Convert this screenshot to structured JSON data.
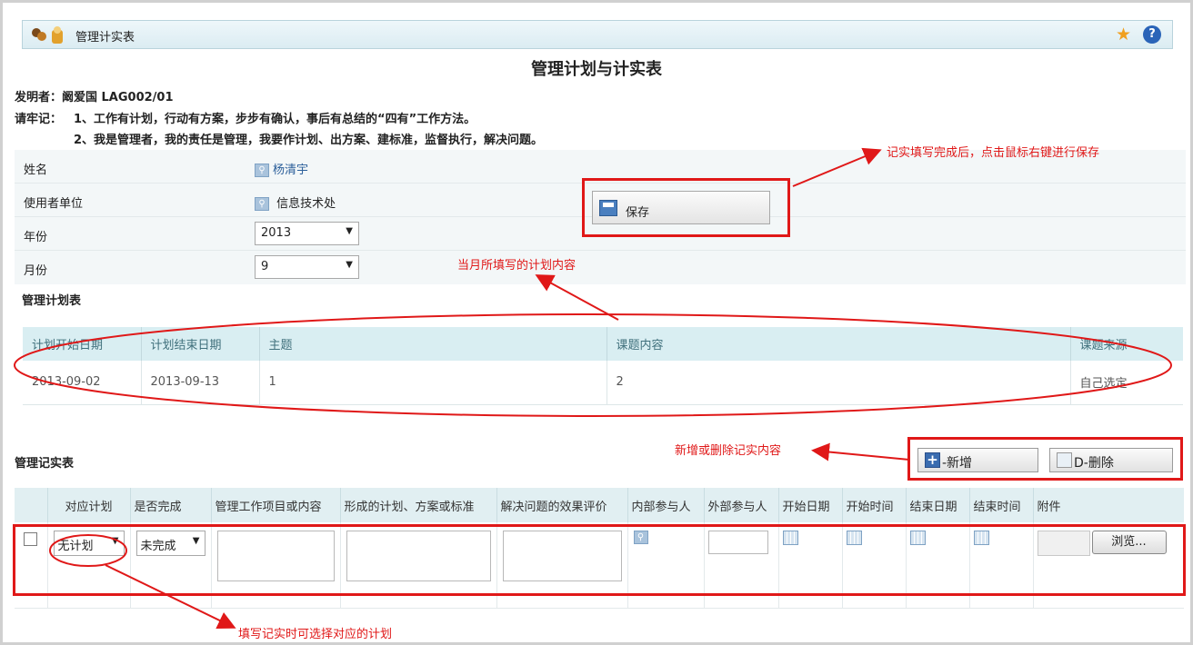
{
  "window": {
    "title": "管理计实表",
    "icons": [
      "users-icon",
      "star-icon",
      "help-icon"
    ]
  },
  "page_title": "管理计划与计实表",
  "inventor_line": "发明者：阚爱国 LAG002/01",
  "reminder_label": "请牢记：",
  "reminder_1": "1、工作有计划，行动有方案，步步有确认，事后有总结的“四有”工作方法。",
  "reminder_2": "2、我是管理者，我的责任是管理，我要作计划、出方案、建标准，监督执行，解决问题。",
  "form": {
    "name_label": "姓名",
    "name_value": "杨清宇",
    "unit_label": "使用者单位",
    "unit_value": "信息技术处",
    "year_label": "年份",
    "year_value": "2013",
    "month_label": "月份",
    "month_value": "9"
  },
  "save_button": "保存",
  "plan_section_title": "管理计划表",
  "plan_table": {
    "headers": [
      "计划开始日期",
      "计划结束日期",
      "主题",
      "课题内容",
      "课题来源"
    ],
    "rows": [
      [
        "2013-09-02",
        "2013-09-13",
        "1",
        "2",
        "自己选定"
      ]
    ]
  },
  "record_section_title": "管理记实表",
  "record_buttons": {
    "add": "-新增",
    "delete": "D-删除"
  },
  "record_table": {
    "headers": [
      "对应计划",
      "是否完成",
      "管理工作项目或内容",
      "形成的计划、方案或标准",
      "解决问题的效果评价",
      "内部参与人",
      "外部参与人",
      "开始日期",
      "开始时间",
      "结束日期",
      "结束时间",
      "附件"
    ],
    "row": {
      "plan_select": "无计划",
      "done_select": "未完成",
      "browse_button": "浏览..."
    }
  },
  "annotations": {
    "save_note": "记实填写完成后，点击鼠标右键进行保存",
    "plan_note": "当月所填写的计划内容",
    "addremove_note": "新增或删除记实内容",
    "select_note": "填写记实时可选择对应的计划"
  },
  "colors": {
    "annotation_red": "#e01818",
    "header_teal": "#d9eef2",
    "link_blue": "#2b5f9a"
  }
}
